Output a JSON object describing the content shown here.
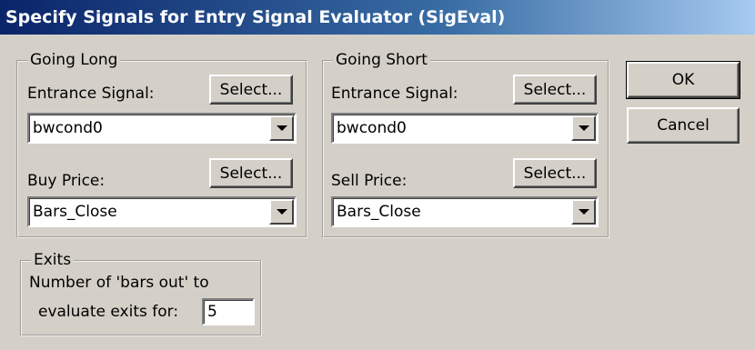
{
  "window": {
    "title": "Specify Signals for Entry Signal Evaluator (SigEval)"
  },
  "going_long": {
    "legend": "Going Long",
    "entrance_label": "Entrance Signal:",
    "entrance_select": "Select...",
    "entrance_value": "bwcond0",
    "price_label": "Buy Price:",
    "price_select": "Select...",
    "price_value": "Bars_Close"
  },
  "going_short": {
    "legend": "Going Short",
    "entrance_label": "Entrance Signal:",
    "entrance_select": "Select...",
    "entrance_value": "bwcond0",
    "price_label": "Sell Price:",
    "price_select": "Select...",
    "price_value": "Bars_Close"
  },
  "buttons": {
    "ok": "OK",
    "cancel": "Cancel"
  },
  "exits": {
    "legend": "Exits",
    "line1": "Number of 'bars out' to",
    "line2": "evaluate exits for:",
    "value": "5"
  },
  "icons": {
    "dropdown": "chevron-down-icon"
  }
}
